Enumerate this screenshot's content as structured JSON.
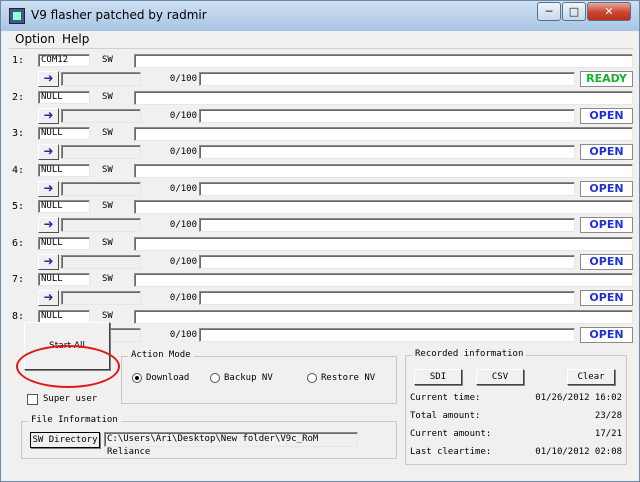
{
  "window": {
    "title": "V9 flasher patched by radmir",
    "minimize": "─",
    "maximize": "□",
    "close": "✕"
  },
  "menu": [
    "Option",
    "Help"
  ],
  "slots": [
    {
      "num": "1:",
      "port": "COM12",
      "sw": "SW",
      "progress": "0/100",
      "status": "READY",
      "status_type": "ready"
    },
    {
      "num": "2:",
      "port": "NULL",
      "sw": "SW",
      "progress": "0/100",
      "status": "OPEN",
      "status_type": "open"
    },
    {
      "num": "3:",
      "port": "NULL",
      "sw": "SW",
      "progress": "0/100",
      "status": "OPEN",
      "status_type": "open"
    },
    {
      "num": "4:",
      "port": "NULL",
      "sw": "SW",
      "progress": "0/100",
      "status": "OPEN",
      "status_type": "open"
    },
    {
      "num": "5:",
      "port": "NULL",
      "sw": "SW",
      "progress": "0/100",
      "status": "OPEN",
      "status_type": "open"
    },
    {
      "num": "6:",
      "port": "NULL",
      "sw": "SW",
      "progress": "0/100",
      "status": "OPEN",
      "status_type": "open"
    },
    {
      "num": "7:",
      "port": "NULL",
      "sw": "SW",
      "progress": "0/100",
      "status": "OPEN",
      "status_type": "open"
    },
    {
      "num": "8:",
      "port": "NULL",
      "sw": "SW",
      "progress": "0/100",
      "status": "OPEN",
      "status_type": "open"
    }
  ],
  "arrow_icon": "arrow-right-icon",
  "start_all": "Start All",
  "super_user": "Super user",
  "action_mode": {
    "title": "Action Mode",
    "options": [
      "Download",
      "Backup NV",
      "Restore NV"
    ],
    "selected": "Download"
  },
  "file_info": {
    "title": "File Information",
    "sw_directory": "SW Directory",
    "path": "C:\\Users\\Ari\\Desktop\\New folder\\V9c_RoM Reliance"
  },
  "recorded": {
    "title": "Recorded information",
    "sdi": "SDI",
    "csv": "CSV",
    "clear": "Clear",
    "rows": [
      {
        "label": "Current time:",
        "value": "01/26/2012 16:02"
      },
      {
        "label": "Total amount:",
        "value": "23/28"
      },
      {
        "label": "Current amount:",
        "value": "17/21"
      },
      {
        "label": "Last cleartime:",
        "value": "01/10/2012 02:08"
      }
    ]
  },
  "colors": {
    "ready": "#17b02a",
    "open": "#1f31d8",
    "highlight": "#e01818"
  }
}
